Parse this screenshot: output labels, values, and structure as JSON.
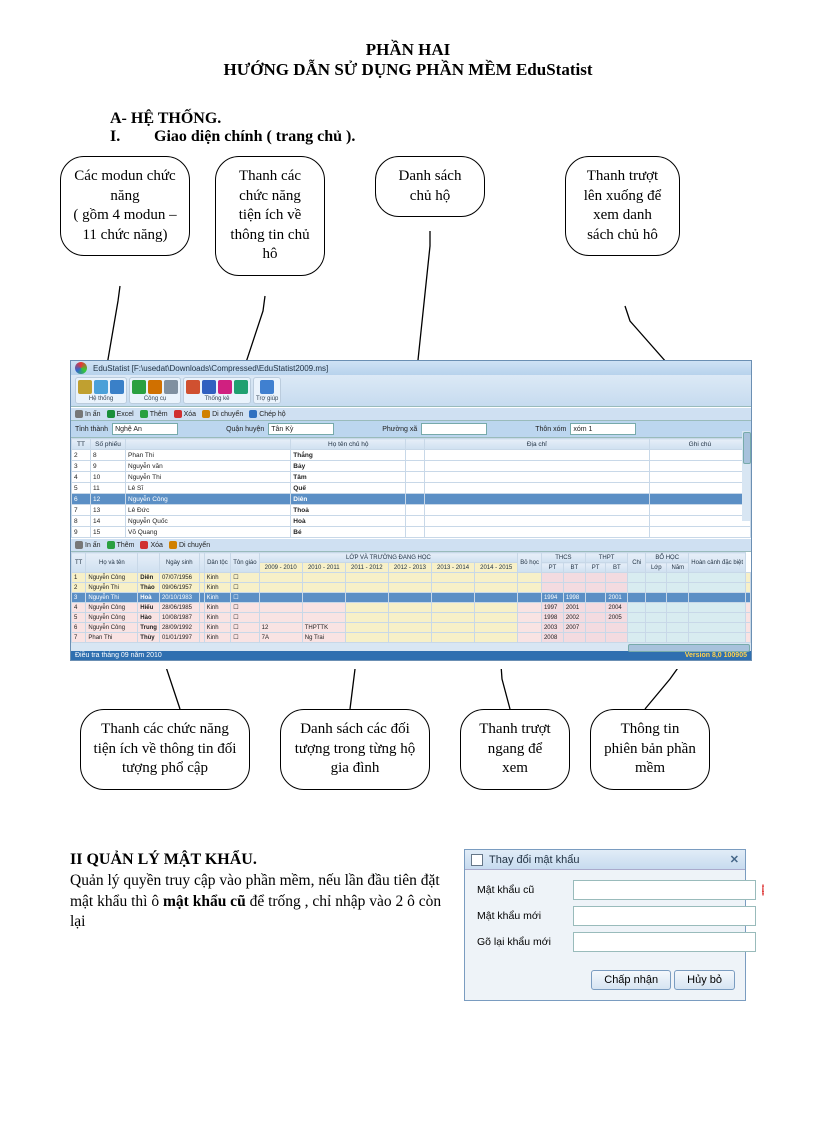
{
  "title_main": "PHẦN HAI",
  "title_sub": "HƯỚNG DẪN SỬ DỤNG PHẦN MỀM   EduStatist",
  "section_a": "A- HỆ THỐNG.",
  "section_i_label": "I.",
  "section_i_text": "Giao diện chính ( trang chủ ).",
  "callouts_top": {
    "c1": "Các modun chức năng\n( gồm 4 modun – 11 chức năng)",
    "c2": "Thanh các chức năng tiện ích về thông tin chủ hô",
    "c3": "Danh sách chủ hộ",
    "c4": "Thanh trượt lên xuống để xem danh sách chủ hô"
  },
  "app": {
    "window_title": "EduStatist [F:\\usedat\\Downloads\\Compressed\\EduStatist2009.ms]",
    "ribbon_groups": [
      {
        "label": "Hệ thống",
        "icons": [
          {
            "name": "key",
            "c": "#c0a030"
          },
          {
            "name": "users",
            "c": "#4aa0d8"
          },
          {
            "name": "db",
            "c": "#3a80c8"
          }
        ]
      },
      {
        "label": "Công cụ",
        "icons": [
          {
            "name": "check",
            "c": "#2aa040"
          },
          {
            "name": "search",
            "c": "#d07000"
          },
          {
            "name": "wrench",
            "c": "#8090a0"
          }
        ]
      },
      {
        "label": "Thống kê",
        "icons": [
          {
            "name": "pie",
            "c": "#d05030"
          },
          {
            "name": "pie2",
            "c": "#3060c0"
          },
          {
            "name": "pie3",
            "c": "#d02080"
          },
          {
            "name": "pie4",
            "c": "#20a070"
          }
        ]
      },
      {
        "label": "Trợ giúp",
        "icons": [
          {
            "name": "help",
            "c": "#4080d0"
          }
        ]
      }
    ],
    "toolbar2": [
      {
        "name": "print",
        "label": "In ấn",
        "c": "#777"
      },
      {
        "name": "excel",
        "label": "Excel",
        "c": "#1a8f3a"
      },
      {
        "name": "add",
        "label": "Thêm",
        "c": "#2aa040"
      },
      {
        "name": "del",
        "label": "Xóa",
        "c": "#d03030"
      },
      {
        "name": "move",
        "label": "Di chuyển",
        "c": "#d08000"
      },
      {
        "name": "split",
        "label": "Chép hộ",
        "c": "#3070c0"
      }
    ],
    "filters": {
      "tinh_label": "Tỉnh thành",
      "tinh_val": "Nghệ An",
      "huyen_label": "Quận huyện",
      "huyen_val": "Tân Kỳ",
      "xa_label": "Phường xã",
      "xa_val": "",
      "xom_label": "Thôn xóm",
      "xom_val": "xóm 1"
    },
    "grid1_headers": [
      "TT",
      "Số phiếu",
      "",
      "Họ tên chủ hộ",
      "",
      "Địa chỉ",
      "Ghi chú"
    ],
    "grid1_rows": [
      [
        "2",
        "8",
        "Phan Thi",
        "",
        "Thắng"
      ],
      [
        "3",
        "9",
        "Nguyễn văn",
        "",
        "Bảy"
      ],
      [
        "4",
        "10",
        "Nguyễn Thi",
        "",
        "Tâm"
      ],
      [
        "5",
        "11",
        "Lê Sĩ",
        "",
        "Quế"
      ],
      [
        "6",
        "12",
        "Nguyễn Công",
        "",
        "Diên"
      ],
      [
        "7",
        "13",
        "Lê Đức",
        "",
        "Thoả"
      ],
      [
        "8",
        "14",
        "Nguyễn Quốc",
        "",
        "Hoà"
      ],
      [
        "9",
        "15",
        "Võ Quang",
        "",
        "Bé"
      ]
    ],
    "grid1_selected_index": 4,
    "toolbar3": [
      {
        "name": "print",
        "label": "In ấn",
        "c": "#777"
      },
      {
        "name": "add",
        "label": "Thêm",
        "c": "#2aa040"
      },
      {
        "name": "del",
        "label": "Xóa",
        "c": "#d03030"
      },
      {
        "name": "move",
        "label": "Di chuyển",
        "c": "#d08000"
      }
    ],
    "grid2_top_header": "LỚP VÀ TRƯỜNG ĐANG HỌC",
    "grid2_sub_headers": [
      "TT",
      "Họ và tên",
      "",
      "Ngày sinh",
      "",
      "Dân tộc",
      "Tôn giáo",
      "2009 - 2010",
      "2010 - 2011",
      "2011 - 2012",
      "2012 - 2013",
      "2013 - 2014",
      "2014 - 2015",
      "Bỏ học",
      "PT",
      "THCS",
      "BT",
      "PT",
      "THPT",
      "BT",
      "Chi",
      "BỔ HỌC",
      "Lớp",
      "Năm",
      "Hoàn cảnh đặc biệt"
    ],
    "grid2_rows": [
      {
        "c": [
          "1",
          "Nguyễn Công",
          "Diên",
          "07/07/1956",
          "",
          "Kinh",
          "☐"
        ],
        "bg": "bg-cream",
        "y": [
          "",
          "",
          "",
          "",
          "",
          "",
          "",
          "",
          "",
          "",
          "",
          "",
          ""
        ]
      },
      {
        "c": [
          "2",
          "Nguyễn Thi",
          "Thảo",
          "09/06/1957",
          "",
          "Kinh",
          "☐"
        ],
        "bg": "bg-cream",
        "y": [
          "",
          "",
          "",
          "",
          "",
          "",
          "",
          "",
          "",
          "",
          "",
          "",
          ""
        ]
      },
      {
        "c": [
          "3",
          "Nguyễn Thi",
          "Hoà",
          "20/10/1983",
          "",
          "Kinh",
          "☐"
        ],
        "bg": "row-sel",
        "y": [
          "",
          "",
          "",
          "",
          "",
          "",
          "1994",
          "1998",
          "",
          "2001",
          "",
          "",
          "",
          ""
        ]
      },
      {
        "c": [
          "4",
          "Nguyễn Công",
          "Hiếu",
          "28/06/1985",
          "",
          "Kinh",
          "☐"
        ],
        "bg": "bg-pink",
        "y": [
          "",
          "",
          "",
          "",
          "",
          "",
          "1997",
          "2001",
          "",
          "2004",
          "",
          "",
          "",
          ""
        ]
      },
      {
        "c": [
          "5",
          "Nguyễn Công",
          "Hào",
          "10/08/1987",
          "",
          "Kinh",
          "☐"
        ],
        "bg": "bg-pink",
        "y": [
          "",
          "",
          "",
          "",
          "",
          "",
          "1998",
          "2002",
          "",
          "2005",
          "",
          "",
          "",
          ""
        ]
      },
      {
        "c": [
          "6",
          "Nguyễn Công",
          "Trung",
          "28/09/1992",
          "",
          "Kinh",
          "☐",
          "12",
          "THPTTK"
        ],
        "bg": "bg-pink",
        "y": [
          "",
          "",
          "",
          "",
          "",
          "",
          "2003",
          "2007",
          "",
          "",
          "",
          "",
          "",
          ""
        ]
      },
      {
        "c": [
          "7",
          "Phan Thi",
          "Thùy",
          "01/01/1997",
          "",
          "Kinh",
          "☐",
          "7A",
          "Ng Trai"
        ],
        "bg": "bg-pink",
        "y": [
          "",
          "",
          "",
          "",
          "",
          "",
          "2008",
          "",
          "",
          "",
          "",
          "",
          "",
          ""
        ]
      }
    ],
    "status_left": "Điều tra tháng 09 năm 2010",
    "status_right": "Version 8,0 100905"
  },
  "callouts_bottom": {
    "c1": "Thanh các chức năng tiện ích về thông tin đối tượng phổ cập",
    "c2": "Danh sách các đối tượng trong từng hộ gia đình",
    "c3": "Thanh trượt ngang để xem",
    "c4": "Thông tin phiên bản phần mềm"
  },
  "section2": {
    "heading": "II QUẢN LÝ MẬT KHẨU.",
    "body1": "Quản lý quyền truy cập vào phần mềm, nếu lần đầu tiên  đặt mật khẩu thì ô ",
    "bold": "mật khẩu cũ",
    "body2": " để trống , chỉ nhập vào 2 ô còn lại"
  },
  "dialog": {
    "title": "Thay đổi mật khẩu",
    "f1": "Mật khẩu cũ",
    "f2": "Mật khẩu mới",
    "f3": "Gõ lại khẩu mới",
    "ok": "Chấp nhận",
    "cancel": "Hủy bỏ"
  }
}
